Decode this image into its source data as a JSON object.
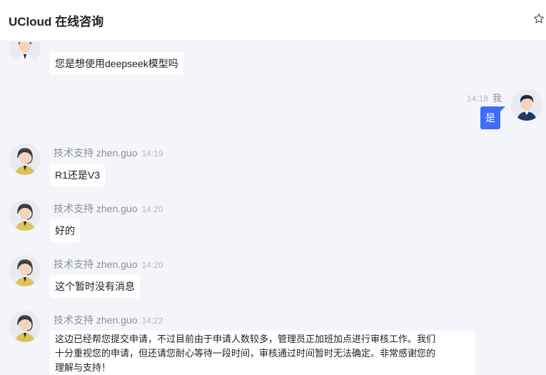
{
  "header": {
    "title": "UCloud 在线咨询",
    "star_icon": "star-outline-icon"
  },
  "messages": [
    {
      "id": "m0",
      "sender": "agent",
      "text": "您是想使用deepseek模型吗"
    },
    {
      "id": "m1",
      "sender": "self",
      "name": "我",
      "time": "14:18",
      "text": "是"
    },
    {
      "id": "m2",
      "sender": "agent",
      "name": "技术支持 zhen.guo",
      "time": "14:19",
      "text": "R1还是V3"
    },
    {
      "id": "m3",
      "sender": "agent",
      "name": "技术支持 zhen.guo",
      "time": "14:20",
      "text": "好的"
    },
    {
      "id": "m4",
      "sender": "agent",
      "name": "技术支持 zhen.guo",
      "time": "14:20",
      "text": "这个暂时没有消息"
    },
    {
      "id": "m5",
      "sender": "agent",
      "name": "技术支持 zhen.guo",
      "time": "14:22",
      "lines": [
        "这边已经帮您提交申请，不过目前由于申请人数较多，管理员正加班加点进行审核工作。我们",
        "十分重视您的申请，但还请您耐心等待一段时间，审核通过时间暂时无法确定。非常感谢您的",
        "理解与支持！"
      ]
    }
  ],
  "colors": {
    "background": "#f4f5fa",
    "self_bubble": "#3d6df5",
    "agent_bubble": "#ffffff"
  }
}
